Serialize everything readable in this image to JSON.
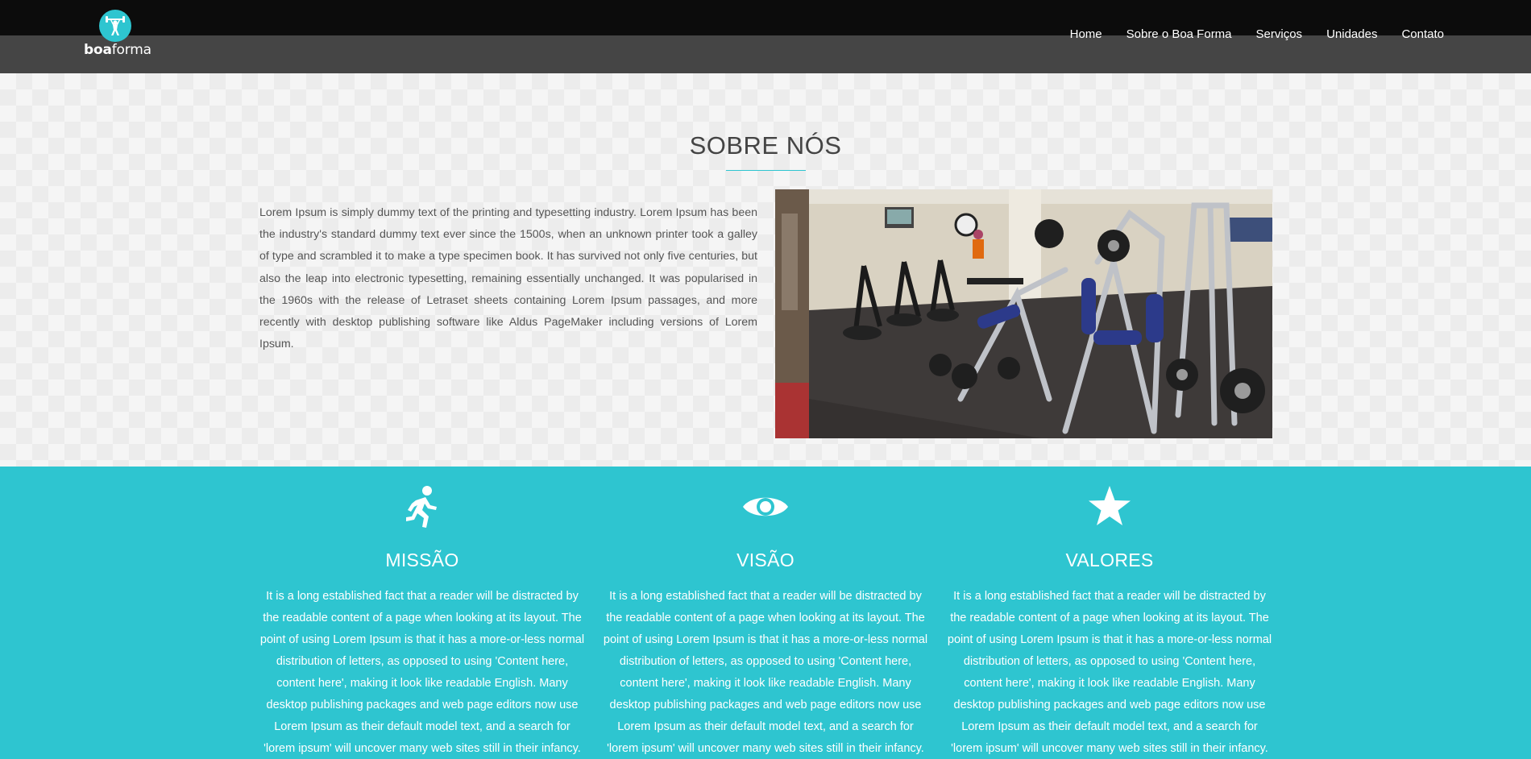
{
  "brand": {
    "bold": "boa",
    "light": "forma"
  },
  "nav": [
    {
      "label": "Home"
    },
    {
      "label": "Sobre o Boa Forma"
    },
    {
      "label": "Serviços"
    },
    {
      "label": "Unidades"
    },
    {
      "label": "Contato"
    }
  ],
  "about": {
    "title": "SOBRE NÓS",
    "text": "Lorem Ipsum is simply dummy text of the printing and typesetting industry. Lorem Ipsum has been the industry's standard dummy text ever since the 1500s, when an unknown printer took a galley of type and scrambled it to make a type specimen book. It has survived not only five centuries, but also the leap into electronic typesetting, remaining essentially unchanged. It was popularised in the 1960s with the release of Letraset sheets containing Lorem Ipsum passages, and more recently with desktop publishing software like Aldus PageMaker including versions of Lorem Ipsum.",
    "carousel": {
      "slides": 3,
      "active": 3
    }
  },
  "features": [
    {
      "icon": "running-person-icon",
      "title": "MISSÃO",
      "text": "It is a long established fact that a reader will be distracted by the readable content of a page when looking at its layout. The point of using Lorem Ipsum is that it has a more-or-less normal distribution of letters, as opposed to using 'Content here, content here', making it look like readable English. Many desktop publishing packages and web page editors now use Lorem Ipsum as their default model text, and a search for 'lorem ipsum' will uncover many web sites still in their infancy."
    },
    {
      "icon": "eye-icon",
      "title": "VISÃO",
      "text": "It is a long established fact that a reader will be distracted by the readable content of a page when looking at its layout. The point of using Lorem Ipsum is that it has a more-or-less normal distribution of letters, as opposed to using 'Content here, content here', making it look like readable English. Many desktop publishing packages and web page editors now use Lorem Ipsum as their default model text, and a search for 'lorem ipsum' will uncover many web sites still in their infancy."
    },
    {
      "icon": "star-icon",
      "title": "VALORES",
      "text": "It is a long established fact that a reader will be distracted by the readable content of a page when looking at its layout. The point of using Lorem Ipsum is that it has a more-or-less normal distribution of letters, as opposed to using 'Content here, content here', making it look like readable English. Many desktop publishing packages and web page editors now use Lorem Ipsum as their default model text, and a search for 'lorem ipsum' will uncover many web sites still in their infancy."
    }
  ],
  "colors": {
    "accent": "#2ec5d0",
    "navbar": "#454545",
    "topstrip": "#0c0c0c"
  }
}
